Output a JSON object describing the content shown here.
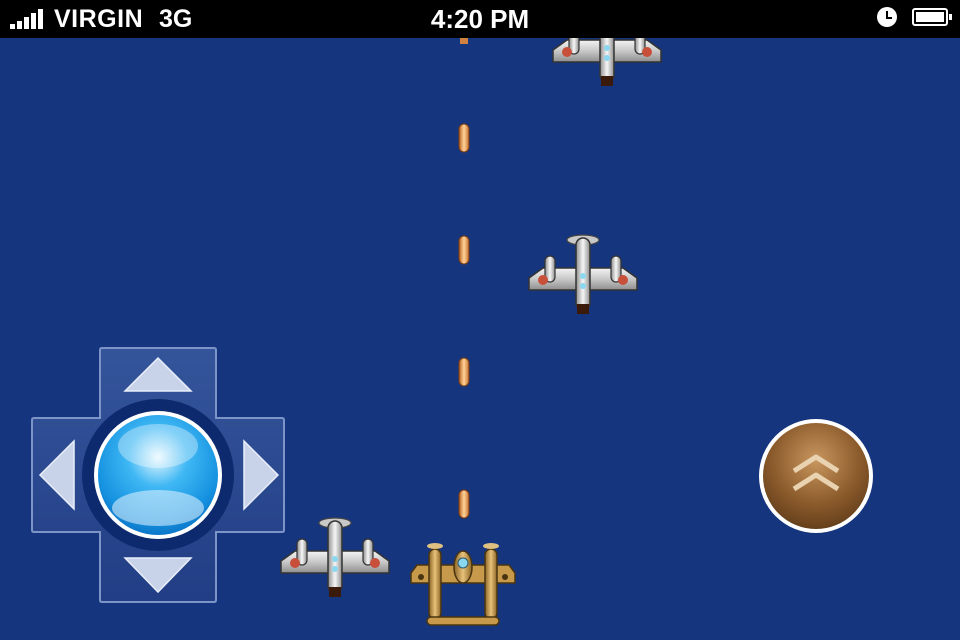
{
  "status_bar": {
    "signal_bars": 5,
    "carrier": "VIRGIN",
    "network": "3G",
    "time": "4:20 PM",
    "alarm_icon": "clock-icon",
    "battery_icon": "battery-full-icon",
    "battery_level": 1.0
  },
  "game": {
    "background_color": "#15367e",
    "player": {
      "sprite": "p38-lightning-twin-boom-plane",
      "color": "#c69a4a"
    },
    "enemies": [
      {
        "sprite": "silver-fighter-plane-partial"
      },
      {
        "sprite": "silver-fighter-plane"
      },
      {
        "sprite": "silver-fighter-plane"
      }
    ],
    "bullets": {
      "count": 4,
      "color": "#f0a050"
    }
  },
  "controls": {
    "dpad": {
      "icon": "directional-pad",
      "up_icon": "triangle-up-icon",
      "down_icon": "triangle-down-icon",
      "left_icon": "triangle-left-icon",
      "right_icon": "triangle-right-icon",
      "center_color": "#1aa0ea"
    },
    "fire_button": {
      "icon": "double-chevron-up-icon",
      "color": "#8a5a2b"
    }
  }
}
